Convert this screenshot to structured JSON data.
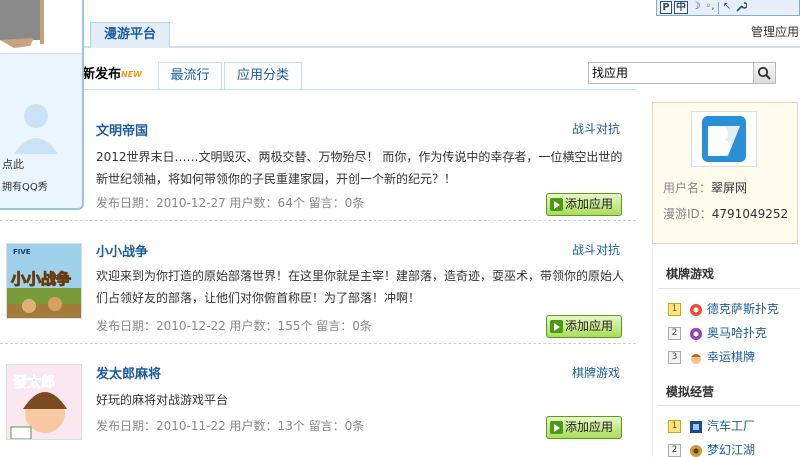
{
  "header": {
    "platform_tab": "漫游平台",
    "manage_link": "管理应用",
    "toolbar": {
      "p_label": "P",
      "zh_label": "中",
      "moon": "☽",
      "dots": "◦,",
      "bar": "|",
      "arrow": "↖",
      "wrench": "🔧"
    }
  },
  "left_panel": {
    "hint1": "点此",
    "hint2": "拥有QQ秀"
  },
  "tabs": {
    "new_label": "新发布",
    "new_badge": "NEW",
    "popular_label": "最流行",
    "category_label": "应用分类"
  },
  "search": {
    "value": "找应用"
  },
  "apps": [
    {
      "title": "文明帝国",
      "category": "战斗对抗",
      "desc": "2012世界末日……文明毁灭、两极交替、万物殆尽！ 而你，作为传说中的幸存者，一位横空出世的新世纪领袖，将如何带领你的子民重建家园，开创一个新的纪元？！",
      "meta": "发布日期：2010-12-27 用户数：64个   留言：0条",
      "add_label": "添加应用"
    },
    {
      "title": "小小战争",
      "category": "战斗对抗",
      "desc": "欢迎来到为你打造的原始部落世界！在这里你就是主宰！建部落，造奇迹，耍巫术，带领你的原始人们占领好友的部落，让他们对你俯首称臣！为了部落！冲啊！",
      "meta": "发布日期：2010-12-22 用户数：155个   留言：0条",
      "add_label": "添加应用",
      "thumb_text": "小小战争",
      "thumb_brand": "FIVE"
    },
    {
      "title": "发太郎麻将",
      "category": "棋牌游戏",
      "desc": "好玩的麻将对战游戏平台",
      "meta": "发布日期：2010-11-22 用户数：13个   留言：0条",
      "add_label": "添加应用",
      "thumb_text": "發太郎"
    }
  ],
  "profile": {
    "username_label": "用户名：",
    "username": "翠屏网",
    "id_label": "漫游ID：",
    "id": "4791049252"
  },
  "sidebar": {
    "chess_title": "棋牌游戏",
    "chess_items": [
      {
        "rank": "1",
        "name": "德克萨斯扑克"
      },
      {
        "rank": "2",
        "name": "奥马哈扑克"
      },
      {
        "rank": "3",
        "name": "幸运棋牌"
      }
    ],
    "sim_title": "模拟经营",
    "sim_items": [
      {
        "rank": "1",
        "name": "汽车工厂"
      },
      {
        "rank": "2",
        "name": "梦幻江湖"
      }
    ]
  }
}
